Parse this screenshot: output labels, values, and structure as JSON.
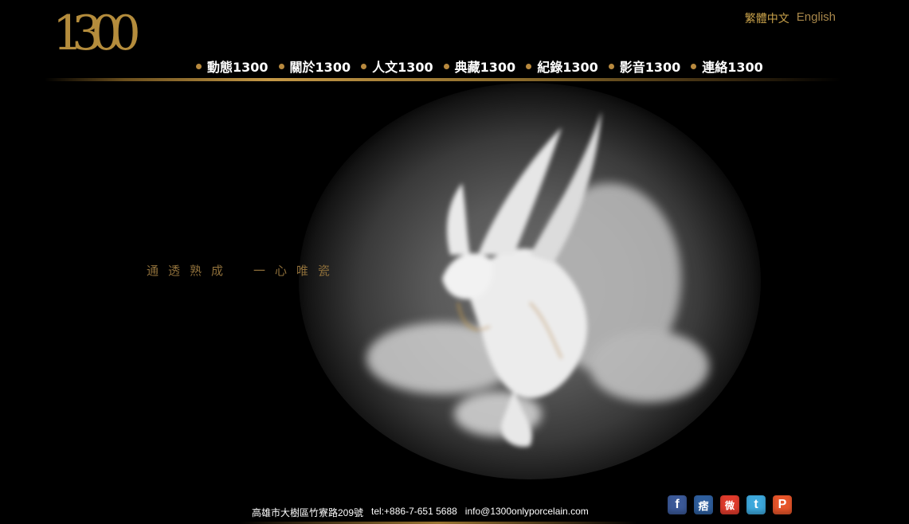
{
  "logo": {
    "text": "1300"
  },
  "language": {
    "chinese": "繁體中文",
    "english": "English"
  },
  "nav": [
    {
      "label": "動態1300"
    },
    {
      "label": "關於1300"
    },
    {
      "label": "人文1300"
    },
    {
      "label": "典藏1300"
    },
    {
      "label": "紀錄1300"
    },
    {
      "label": "影音1300"
    },
    {
      "label": "連絡1300"
    }
  ],
  "hero": {
    "tagline_left": "通透熟成",
    "tagline_right": "一心唯瓷"
  },
  "footer": {
    "address": "高雄市大樹區竹寮路209號",
    "tel": "tel:+886-7-651 5688",
    "email": "info@1300onlyporcelain.com"
  },
  "social": [
    {
      "icon": "facebook-icon",
      "glyph": "f"
    },
    {
      "icon": "plurk-pen-icon",
      "glyph": "痞"
    },
    {
      "icon": "weibo-icon",
      "glyph": "微"
    },
    {
      "icon": "twitter-icon",
      "glyph": "t"
    },
    {
      "icon": "plurk-icon",
      "glyph": "P"
    }
  ],
  "colors": {
    "background": "#000000",
    "accent_gold": "#b8923f",
    "nav_text": "#ffffff"
  }
}
